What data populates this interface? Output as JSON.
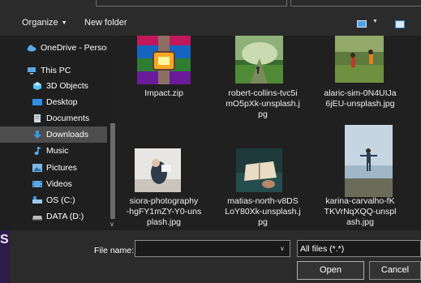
{
  "toolbar": {
    "organize_label": "Organize",
    "new_folder_label": "New folder",
    "view_options_icon": "view-options-icon",
    "preview_pane_icon": "preview-pane-icon"
  },
  "nav": {
    "items": [
      {
        "label": "OneDrive - Person",
        "icon": "cloud-icon",
        "color": "#5aa9e6"
      },
      {
        "label": "This PC",
        "icon": "computer-icon",
        "color": "#5aa9e6"
      },
      {
        "label": "3D Objects",
        "icon": "cube-icon",
        "color": "#4fc3f7"
      },
      {
        "label": "Desktop",
        "icon": "desktop-icon",
        "color": "#2f8de4"
      },
      {
        "label": "Documents",
        "icon": "document-icon",
        "color": "#cfd8dc"
      },
      {
        "label": "Downloads",
        "icon": "download-icon",
        "color": "#3a96dd"
      },
      {
        "label": "Music",
        "icon": "music-icon",
        "color": "#5aa9e6"
      },
      {
        "label": "Pictures",
        "icon": "pictures-icon",
        "color": "#7fb8e6"
      },
      {
        "label": "Videos",
        "icon": "video-icon",
        "color": "#5aa9e6"
      },
      {
        "label": "OS (C:)",
        "icon": "drive-icon",
        "color": "#9ecbe9"
      },
      {
        "label": "DATA (D:)",
        "icon": "drive-icon",
        "color": "#bdbdbd"
      }
    ],
    "selected_index": 5
  },
  "files": [
    {
      "name": "Impact.zip",
      "icon": "winrar-archive-icon"
    },
    {
      "name": "robert-collins-tvc5imO5pXk-unsplash.jpg",
      "icon": "photo-thumbnail"
    },
    {
      "name": "alaric-sim-0N4UIJa6jEU-unsplash.jpg",
      "icon": "photo-thumbnail"
    },
    {
      "name": "siora-photography-hgFY1mZY-Y0-unsplash.jpg",
      "icon": "photo-thumbnail"
    },
    {
      "name": "matias-north-v8DSLoY80Xk-unsplash.jpg",
      "icon": "photo-thumbnail"
    },
    {
      "name": "karina-carvalho-fKTKVrNqXQQ-unsplash.jpg",
      "icon": "photo-thumbnail"
    }
  ],
  "labels": {
    "f0": "Impact.zip",
    "f1": "robert-collins-tvc5i\nmO5pXk-unsplash.j\npg",
    "f2": "alaric-sim-0N4UIJa\n6jEU-unsplash.jpg",
    "f3": "siora-photography\n-hgFY1mZY-Y0-uns\nplash.jpg",
    "f4": "matias-north-v8DS\nLoY80Xk-unsplash.j\npg",
    "f5": "karina-carvalho-fK\nTKVrNqXQQ-unspl\nash.jpg"
  },
  "bottom": {
    "filename_label": "File name:",
    "filename_value": "",
    "filter_value": "All files (*.*)",
    "open_label": "Open",
    "cancel_label": "Cancel",
    "side_letter": "S"
  },
  "colors": {
    "background": "#2b2b2b",
    "content_bg": "#202020",
    "selected": "#4d4d4d",
    "accent": "#5aa9e6"
  }
}
